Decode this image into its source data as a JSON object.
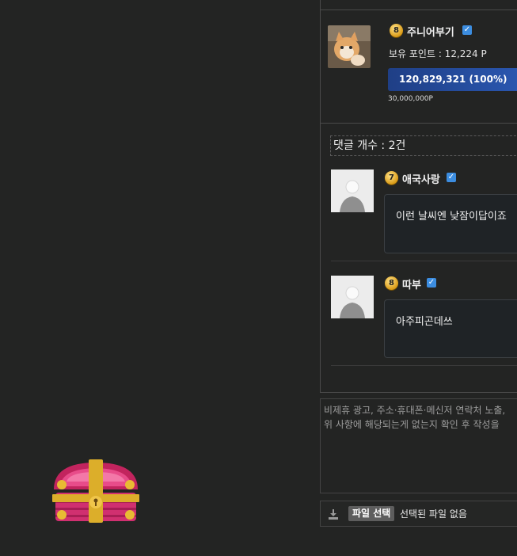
{
  "author": {
    "level": "8",
    "name": "주니어부기",
    "points_label": "보유 포인트 : 12,224 P",
    "progress_text": "120,829,321 (100%)",
    "progress_fraction": 1.0,
    "progress_sub": "30,000,000P"
  },
  "comments": {
    "count_label": "댓글 개수 : 2건",
    "items": [
      {
        "level": "7",
        "name": "애국사랑",
        "text": "이런 날씨엔 낮잠이답이죠"
      },
      {
        "level": "8",
        "name": "따부",
        "text": "아주피곤데쓰"
      }
    ]
  },
  "compose": {
    "placeholder_line1": "비제휴 광고, 주소·휴대폰·메신저 연락처 노출,",
    "placeholder_line2": "위 사항에 해당되는게 없는지 확인 후 작성을"
  },
  "file": {
    "button_label": "파일 선택",
    "status": "선택된 파일 없음"
  },
  "colors": {
    "background": "#232423",
    "progress": "#2a57b0",
    "verify": "#3c8de0"
  },
  "icons": [
    "treasure-chest-icon",
    "level-badge-icon",
    "verified-icon",
    "download-icon",
    "default-avatar-icon"
  ]
}
